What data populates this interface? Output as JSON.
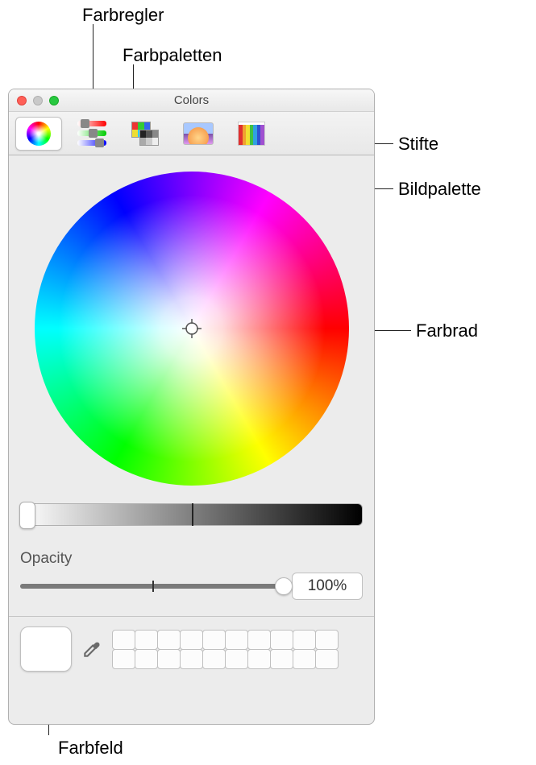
{
  "window": {
    "title": "Colors"
  },
  "toolbar": {
    "tabs": {
      "wheel": {
        "selected": true
      },
      "sliders": {
        "selected": false
      },
      "palettes": {
        "selected": false
      },
      "image": {
        "selected": false
      },
      "pencils": {
        "selected": false
      }
    }
  },
  "opacity": {
    "label": "Opacity",
    "value_text": "100%",
    "value": 100
  },
  "brightness": {
    "value": 0
  },
  "callouts": {
    "farbregler": "Farbregler",
    "farbpaletten": "Farbpaletten",
    "stifte": "Stifte",
    "bildpalette": "Bildpalette",
    "farbrad": "Farbrad",
    "farbfeld": "Farbfeld"
  }
}
